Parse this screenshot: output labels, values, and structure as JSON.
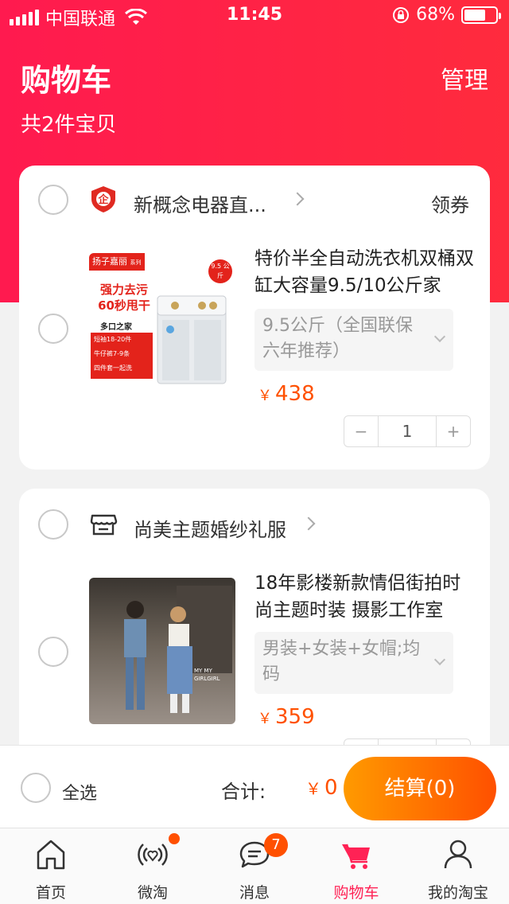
{
  "status_bar": {
    "carrier": "中国联通",
    "time": "11:45",
    "battery": "68%"
  },
  "header": {
    "title": "购物车",
    "manage": "管理",
    "count": "共2件宝贝"
  },
  "cart": {
    "shops": [
      {
        "name": "新概念电器直...",
        "coupon": "领券",
        "item": {
          "title": "特价半全自动洗衣机双桶双缸大容量9.5/10公斤家",
          "sku": "9.5公斤（全国联保六年推荐）",
          "currency": "￥",
          "price": "438",
          "quantity": "1",
          "thumb_text": {
            "brand": "扬子嘉丽",
            "series": "系列",
            "badge": "9.5 公斤",
            "headline1": "强力去污",
            "headline2": "60秒甩干",
            "sub": "多口之家",
            "line1": "短袖18-20件",
            "line2": "牛仔裤7-9条",
            "line3": "四件套一起洗"
          }
        }
      },
      {
        "name": "尚美主题婚纱礼服",
        "item": {
          "title": "18年影楼新款情侣街拍时尚主题时装 摄影工作室",
          "sku": "男装+女装+女帽;均码",
          "currency": "￥",
          "price": "359",
          "thumb_text": {
            "tag": "MY MY GIRLGIRL"
          }
        }
      }
    ]
  },
  "footer": {
    "select_all": "全选",
    "total_label": "合计:",
    "currency": "￥",
    "total_value": "0",
    "checkout": "结算(0)"
  },
  "tabs": [
    {
      "label": "首页",
      "icon": "home-icon"
    },
    {
      "label": "微淘",
      "icon": "weitao-icon"
    },
    {
      "label": "消息",
      "icon": "message-icon",
      "badge": "7"
    },
    {
      "label": "购物车",
      "icon": "cart-icon",
      "active": true
    },
    {
      "label": "我的淘宝",
      "icon": "profile-icon"
    }
  ],
  "colors": {
    "accent": "#ff2255",
    "price": "#ff5000",
    "header": "#ff1a4f"
  }
}
